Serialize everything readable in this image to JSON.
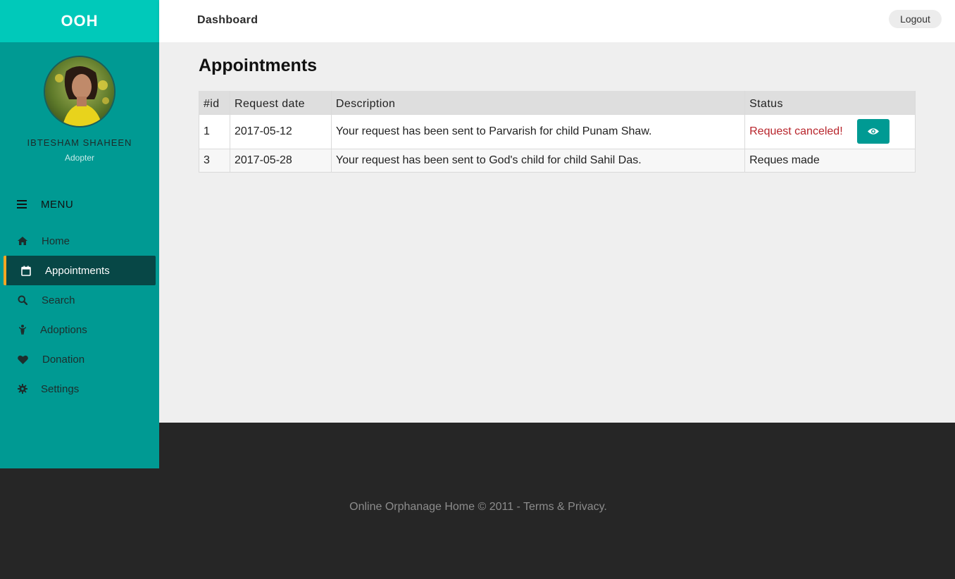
{
  "brand": "OOH",
  "header": {
    "title": "Dashboard",
    "logout_label": "Logout"
  },
  "user": {
    "name": "IBTESHAM SHAHEEN",
    "role": "Adopter",
    "avatar": "user-avatar-photo"
  },
  "menu": {
    "heading": "MENU",
    "heading_icon": "bars-icon",
    "items": [
      {
        "label": "Home",
        "icon": "home-icon",
        "active": false
      },
      {
        "label": "Appointments",
        "icon": "calendar-icon",
        "active": true
      },
      {
        "label": "Search",
        "icon": "search-icon",
        "active": false
      },
      {
        "label": "Adoptions",
        "icon": "child-icon",
        "active": false
      },
      {
        "label": "Donation",
        "icon": "heart-icon",
        "active": false
      },
      {
        "label": "Settings",
        "icon": "gear-icon",
        "active": false
      }
    ]
  },
  "main": {
    "title": "Appointments",
    "table": {
      "headers": [
        "#id",
        "Request date",
        "Description",
        "Status"
      ],
      "rows": [
        {
          "id": "1",
          "date": "2017-05-12",
          "description": "Your request has been sent to Parvarish for child Punam Shaw.",
          "status": "Request canceled!",
          "status_color": "#b8252c",
          "action_icon": "eye-icon"
        },
        {
          "id": "3",
          "date": "2017-05-28",
          "description": "Your request has been sent to God's child for child Sahil Das.",
          "status": "Reques made"
        }
      ]
    }
  },
  "footer": {
    "text": "Online Orphanage Home © 2011 - Terms & Privacy."
  },
  "colors": {
    "brand": "#00c9ba",
    "sidebar": "#009a93",
    "active_nav": "#074746",
    "active_accent": "#f5a623",
    "footer": "#262626"
  }
}
